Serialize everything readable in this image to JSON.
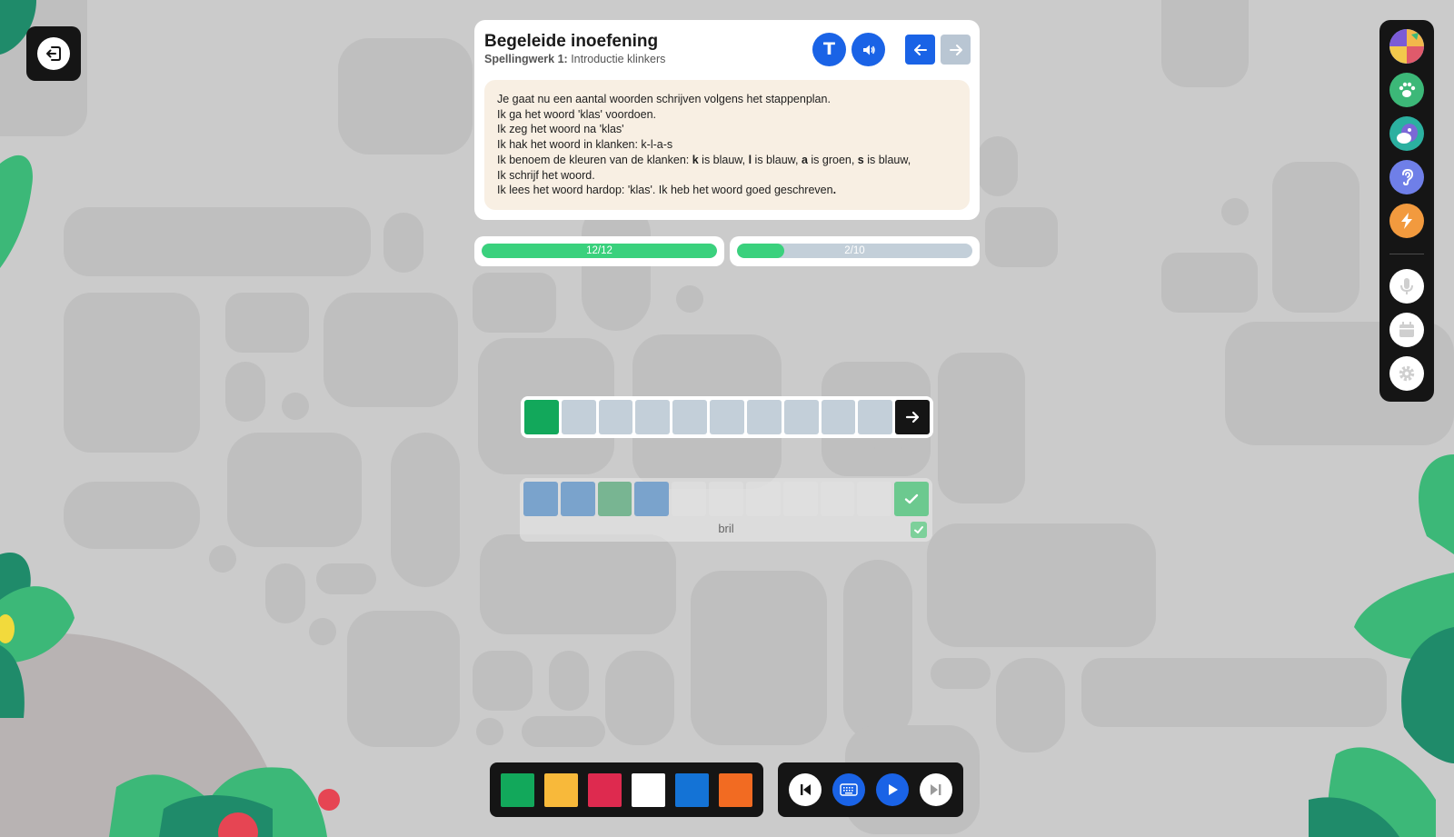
{
  "header": {
    "title": "Begeleide inoefening",
    "subtitle_bold": "Spellingwerk 1:",
    "subtitle": "Introductie klinkers"
  },
  "controls": {
    "text_icon": "text-icon",
    "sound_icon": "speaker-icon",
    "prev_icon": "arrow-left-icon",
    "next_icon": "arrow-right-icon",
    "next_enabled": false
  },
  "instructions": {
    "line1": "Je gaat nu een aantal woorden schrijven volgens het stappenplan.",
    "line2": "Ik ga het woord 'klas' voordoen.",
    "line3": "Ik zeg het woord na 'klas'",
    "line4": "Ik hak het woord in klanken: k-l-a-s",
    "line5_prefix": "Ik benoem de kleuren van de klanken: ",
    "k": "k",
    "k_text": " is blauw, ",
    "l": "l",
    "l_text": " is blauw, ",
    "a": "a",
    "a_text": " is groen, ",
    "s": "s",
    "s_text": " is blauw,",
    "line6": "Ik schrijf het woord.",
    "line7_prefix": "Ik lees het woord hardop: 'klas'. Ik heb het woord goed geschreven",
    "line7_dot": "."
  },
  "progress": [
    {
      "label": "12/12",
      "fraction": 1.0
    },
    {
      "label": "2/10",
      "fraction": 0.2
    }
  ],
  "word_row": {
    "tiles": [
      "green",
      "empty",
      "empty",
      "empty",
      "empty",
      "empty",
      "empty",
      "empty",
      "empty",
      "empty"
    ],
    "submit_icon": "arrow-right-icon"
  },
  "answer": {
    "tiles": [
      "blue",
      "blue",
      "green",
      "blue",
      "empty",
      "empty",
      "empty",
      "empty",
      "empty",
      "empty"
    ],
    "word": "bril",
    "status_icon": "check-icon"
  },
  "sidebar": {
    "items": [
      "chart-icon",
      "paw-icon",
      "animal-icon",
      "ear-icon",
      "lightning-icon",
      "microphone-icon",
      "calendar-icon",
      "gear-icon"
    ]
  },
  "colors": {
    "accent_blue": "#1a63e6",
    "progress_green": "#3ad17d",
    "swatches": [
      "#12a85b",
      "#f8b93a",
      "#de2a4f",
      "#ffffff",
      "#1473d6",
      "#f26b22"
    ]
  },
  "player": {
    "buttons": [
      "skip-back-icon",
      "keyboard-icon",
      "play-icon",
      "skip-forward-icon"
    ]
  }
}
